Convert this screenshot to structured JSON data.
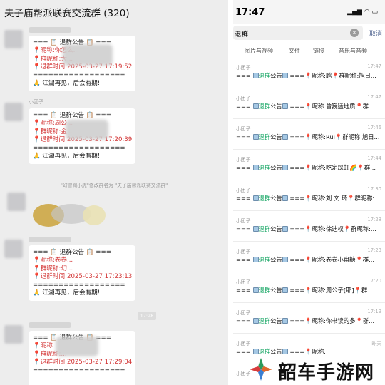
{
  "left": {
    "title": "夫子庙帮派联赛交流群 (320)",
    "messages": [
      {
        "sender": "小团子",
        "lines": [
          "=== 📋 退群公告 📋 ===",
          "📍昵称:你怎么...",
          "📍群昵称:大...",
          "📍退群时间:2025-03-27 17:19:52",
          "==================",
          "🙏 江湖再见，后会有期!"
        ]
      },
      {
        "sender": "小团子",
        "lines": [
          "=== 📋 退群公告 📋 ===",
          "📍昵称:周公...",
          "📍群昵称:金...",
          "📍退群时间:2025-03-27 17:20:39",
          "==================",
          "🙏 江湖再见，后会有期!"
        ]
      },
      {
        "sender": "小团子",
        "lines": [
          "=== 📋 退群公告 📋 ===",
          "📍昵称:卷卷...",
          "📍群昵称:幻...",
          "📍退群时间:2025-03-27 17:23:13",
          "==================",
          "🙏 江湖再见，后会有期!"
        ]
      },
      {
        "sender": "小团子",
        "lines": [
          "=== 📋 退群公告 📋 ===",
          "📍昵称",
          "📍群昵称:...",
          "📍退群时间:2025-03-27 17:29:04",
          "=================="
        ]
      }
    ],
    "system_notice": "\"幻雪阁小虎\"修改群名为 \"夫子庙帮派联赛交流群\"",
    "time_divider": "17:28"
  },
  "right": {
    "clock": "17:47",
    "status_icons": "▂▄▆ ◠ ▭",
    "search_value": "退群",
    "clear_icon": "×",
    "cancel_label": "取消",
    "filter_tabs": [
      "图片与视频",
      "文件",
      "链接",
      "音乐与音频"
    ],
    "results": [
      {
        "sender": "小团子",
        "time": "17:47",
        "nick": "昵称:鹏",
        "tail": "群昵称:旭日..."
      },
      {
        "sender": "小团子",
        "time": "17:47",
        "nick": "昵称:曾巍猛地质",
        "tail": "群..."
      },
      {
        "sender": "小团子",
        "time": "17:46",
        "nick": "昵称:Rui",
        "tail": "群昵称:旭日..."
      },
      {
        "sender": "小团子",
        "time": "17:44",
        "nick": "昵称:吃定踩虹🌈",
        "tail": "群..."
      },
      {
        "sender": "小团子",
        "time": "17:30",
        "nick": "昵称:刘 文 琦",
        "tail": "群昵称:..."
      },
      {
        "sender": "小团子",
        "time": "17:28",
        "nick": "昵称:徐迪权",
        "tail": "群昵称:..."
      },
      {
        "sender": "小团子",
        "time": "17:23",
        "nick": "昵称:卷卷小盘糖",
        "tail": "群..."
      },
      {
        "sender": "小团子",
        "time": "17:20",
        "nick": "昵称:周公子[耶]",
        "tail": "群..."
      },
      {
        "sender": "小团子",
        "time": "17:19",
        "nick": "昵称:你书读的多",
        "tail": "群..."
      },
      {
        "sender": "小团子",
        "time": "昨天",
        "nick": "昵称:",
        "tail": ""
      }
    ],
    "result_prefix": "===",
    "result_keyword": "退群",
    "result_mid": "公告",
    "result_sep": "===",
    "last_sender": "小团子"
  },
  "watermark": {
    "text": "韶车手游网",
    "colors": [
      "#2d9a5b",
      "#e0672b",
      "#3b7fd1",
      "#d83b3b"
    ]
  }
}
